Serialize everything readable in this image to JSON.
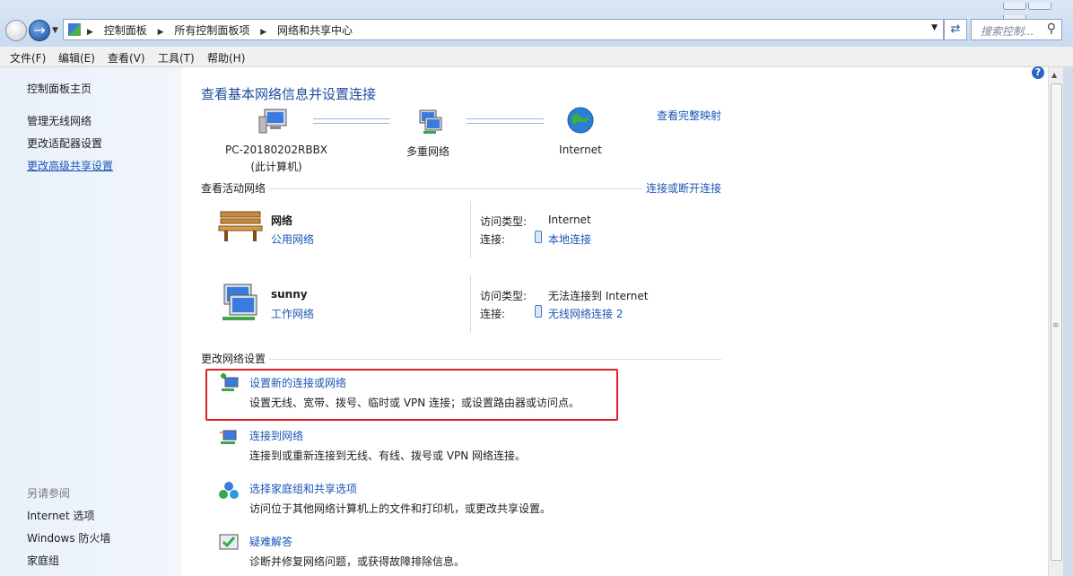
{
  "address": {
    "crumbs": [
      "控制面板",
      "所有控制面板项",
      "网络和共享中心"
    ],
    "search_placeholder": "搜索控制...",
    "refresh_icon": "refresh-icon",
    "search_icon": "search-icon"
  },
  "menu": [
    "文件(F)",
    "编辑(E)",
    "查看(V)",
    "工具(T)",
    "帮助(H)"
  ],
  "sidebar": {
    "home": "控制面板主页",
    "items": [
      "管理无线网络",
      "更改适配器设置",
      "更改高级共享设置"
    ],
    "see_also_header": "另请参阅",
    "see_also": [
      "Internet 选项",
      "Windows 防火墙",
      "家庭组"
    ]
  },
  "main": {
    "title": "查看基本网络信息并设置连接",
    "full_map_link": "查看完整映射",
    "map": {
      "computer_name": "PC-20180202RBBX",
      "computer_sub": "(此计算机)",
      "multi_network": "多重网络",
      "internet": "Internet"
    },
    "active_header": "查看活动网络",
    "connect_disconnect": "连接或断开连接",
    "networks": [
      {
        "name": "网络",
        "type": "公用网络",
        "access_label": "访问类型:",
        "access": "Internet",
        "conn_label": "连接:",
        "conn": "本地连接",
        "icon": "bench-icon"
      },
      {
        "name": "sunny",
        "type": "工作网络",
        "access_label": "访问类型:",
        "access": "无法连接到 Internet",
        "conn_label": "连接:",
        "conn": "无线网络连接 2",
        "icon": "work-network-icon"
      }
    ],
    "change_header": "更改网络设置",
    "tasks": [
      {
        "title": "设置新的连接或网络",
        "desc": "设置无线、宽带、拨号、临时或 VPN 连接；或设置路由器或访问点。"
      },
      {
        "title": "连接到网络",
        "desc": "连接到或重新连接到无线、有线、拨号或 VPN 网络连接。"
      },
      {
        "title": "选择家庭组和共享选项",
        "desc": "访问位于其他网络计算机上的文件和打印机，或更改共享设置。"
      },
      {
        "title": "疑难解答",
        "desc": "诊断并修复网络问题，或获得故障排除信息。"
      }
    ]
  },
  "help_label": "?"
}
